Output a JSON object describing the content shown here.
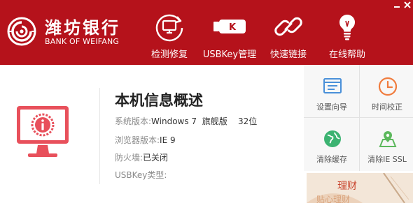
{
  "header": {
    "background": "#b5121b",
    "brand": {
      "name_cn": "潍坊银行",
      "name_en": "BANK OF WEIFANG",
      "logo_icon": "bank-swirl-logo"
    },
    "nav": [
      {
        "label": "检测修复",
        "icon": "monitor-refresh-icon"
      },
      {
        "label": "USBKey管理",
        "icon": "usbkey-icon"
      },
      {
        "label": "快速链接",
        "icon": "link-icon"
      },
      {
        "label": "在线帮助",
        "icon": "lightbulb-icon"
      }
    ],
    "window_controls": {
      "minimize": "minimize-icon",
      "close": "close-icon"
    }
  },
  "info": {
    "title": "本机信息概述",
    "rows": [
      {
        "key": "系统版本:",
        "value": "Windows 7  旗舰版    32位"
      },
      {
        "key": "浏览器版本:",
        "value": "IE 9"
      },
      {
        "key": "防火墙:",
        "value": "已关闭"
      },
      {
        "key": "USBKey类型:",
        "value": ""
      }
    ],
    "monitor_icon": "monitor-info-icon",
    "accent": "#e8505b"
  },
  "tools": [
    {
      "label": "设置向导",
      "icon": "setup-wizard-icon",
      "color": "#4a90d9"
    },
    {
      "label": "时间校正",
      "icon": "clock-icon",
      "color": "#f07c3e"
    },
    {
      "label": "清除缓存",
      "icon": "globe-clear-icon",
      "color": "#3cb371"
    },
    {
      "label": "清除IE SSL",
      "icon": "location-ssl-icon",
      "color": "#5cb85c"
    }
  ],
  "ad": {
    "text1": "理财",
    "text2": "贴心理财"
  }
}
